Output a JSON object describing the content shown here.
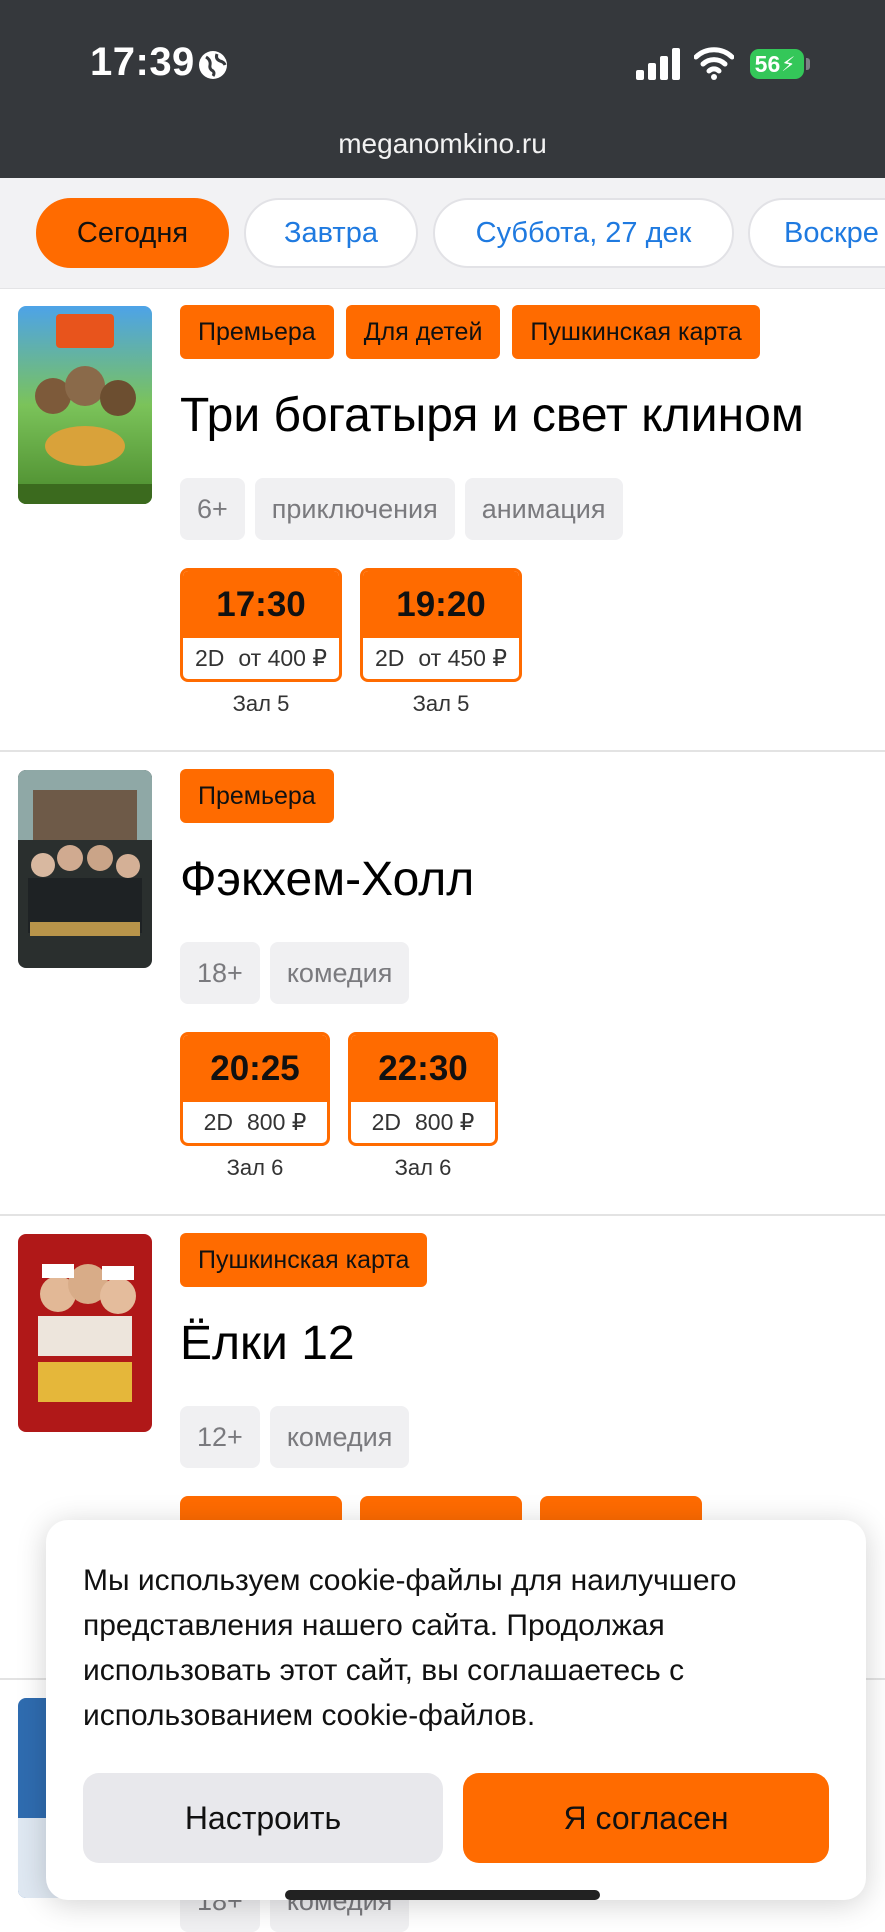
{
  "status_bar": {
    "time": "17:39",
    "battery": "56",
    "url": "meganomkino.ru"
  },
  "date_tabs": [
    {
      "label": "Сегодня",
      "active": true
    },
    {
      "label": "Завтра"
    },
    {
      "label": "Суббота, 27 дек"
    },
    {
      "label": "Воскре"
    }
  ],
  "movies": [
    {
      "title": "Три богатыря и свет клином",
      "tags": [
        "Премьера",
        "Для детей",
        "Пушкинская карта"
      ],
      "meta": [
        "6+",
        "приключения",
        "анимация"
      ],
      "sessions": [
        {
          "time": "17:30",
          "format": "2D",
          "price": "от 400 ₽",
          "hall": "Зал 5"
        },
        {
          "time": "19:20",
          "format": "2D",
          "price": "от 450 ₽",
          "hall": "Зал 5"
        }
      ]
    },
    {
      "title": "Фэкхем-Холл",
      "tags": [
        "Премьера"
      ],
      "meta": [
        "18+",
        "комедия"
      ],
      "sessions": [
        {
          "time": "20:25",
          "format": "2D",
          "price": "800 ₽",
          "hall": "Зал 6"
        },
        {
          "time": "22:30",
          "format": "2D",
          "price": "800 ₽",
          "hall": "Зал 6"
        }
      ]
    },
    {
      "title": "Ёлки 12",
      "tags": [
        "Пушкинская карта"
      ],
      "meta": [
        "12+",
        "комедия"
      ]
    },
    {
      "meta": [
        "18+",
        "комедия"
      ]
    }
  ],
  "cookie_banner": {
    "text": "Мы используем cookie-файлы для наилучшего представления нашего сайта. Продолжая использовать этот сайт, вы соглашаетесь с использованием cookie-файлов.",
    "configure_label": "Настроить",
    "agree_label": "Я согласен"
  },
  "colors": {
    "accent": "#ff6b00",
    "link": "#1f7ae0",
    "status_bar": "#35383c",
    "battery": "#34c759"
  },
  "icons": [
    "globe-icon",
    "signal-icon",
    "wifi-icon",
    "battery-icon"
  ]
}
